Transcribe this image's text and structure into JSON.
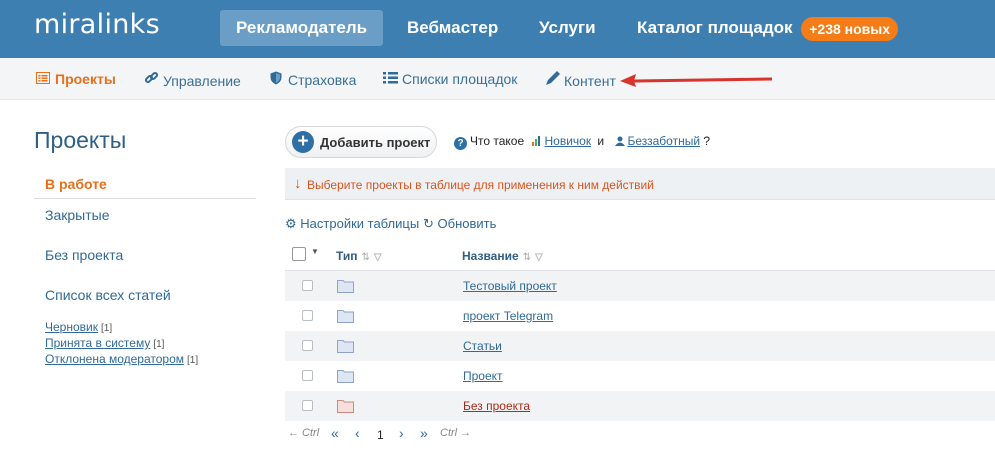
{
  "logo": "miralinks",
  "top_nav": [
    {
      "label": "Рекламодатель",
      "active": true
    },
    {
      "label": "Вебмастер"
    },
    {
      "label": "Услуги"
    },
    {
      "label": "Каталог площадок"
    }
  ],
  "catalog_badge": "+238 новых",
  "sub_nav": [
    {
      "label": "Проекты",
      "icon": "list-icon",
      "active": true
    },
    {
      "label": "Управление",
      "icon": "link-icon"
    },
    {
      "label": "Страховка",
      "icon": "shield-icon"
    },
    {
      "label": "Списки площадок",
      "icon": "bullet-list-icon"
    },
    {
      "label": "Контент",
      "icon": "pen-icon"
    }
  ],
  "sidebar": {
    "title": "Проекты",
    "items": [
      "В работе",
      "Закрытые",
      "Без проекта",
      "Список всех статей"
    ],
    "statuses": [
      {
        "label": "Черновик",
        "count": "[1]"
      },
      {
        "label": "Принята в систему",
        "count": "[1]"
      },
      {
        "label": "Отклонена модератором",
        "count": "[1]"
      }
    ]
  },
  "main": {
    "add_button": "Добавить проект",
    "whatis_prefix": "Что такое",
    "whatis_link1": "Новичок",
    "whatis_and": "и",
    "whatis_link2": "Беззаботный",
    "whatis_suffix": "?",
    "notice_arrow": "↓",
    "notice": "Выберите проекты в таблице для применения к ним действий",
    "table_settings": "Настройки таблицы",
    "refresh": "Обновить"
  },
  "table": {
    "columns": [
      "Тип",
      "Название"
    ],
    "rows": [
      {
        "name": "Тестовый проект"
      },
      {
        "name": "проект Telegram"
      },
      {
        "name": "Статьи"
      },
      {
        "name": "Проект"
      },
      {
        "name": "Без проекта",
        "highlight": "red"
      }
    ]
  },
  "pager": {
    "prev_hint": "← Ctrl",
    "next_hint": "Ctrl →",
    "first": "«",
    "prev": "‹",
    "page": "1",
    "next": "›",
    "last": "»"
  },
  "colors": {
    "header_bg": "#3e7fb1",
    "accent_orange": "#e8701a",
    "link_blue": "#2f6a98",
    "badge_orange": "#f57c16",
    "alert_red": "#d9541e"
  }
}
